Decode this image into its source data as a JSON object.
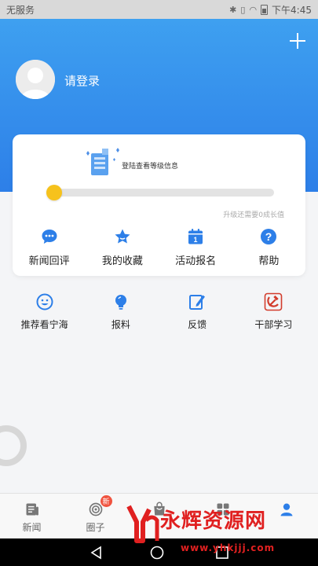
{
  "status_bar": {
    "carrier": "无服务",
    "time": "下午4:45"
  },
  "header": {
    "login_label": "请登录",
    "plus_icon": "plus-icon"
  },
  "card": {
    "level_hint": "登陆查看等级信息",
    "progress_fraction": 0.0,
    "upgrade_note": "升级还需要0成长值",
    "actions": [
      {
        "label": "新闻回评",
        "icon": "chat-bubble-icon"
      },
      {
        "label": "我的收藏",
        "icon": "star-icon"
      },
      {
        "label": "活动报名",
        "icon": "calendar-icon"
      },
      {
        "label": "帮助",
        "icon": "help-icon"
      }
    ]
  },
  "quick_row": [
    {
      "label": "推荐看宁海",
      "icon": "smile-face-icon"
    },
    {
      "label": "报料",
      "icon": "lightbulb-icon"
    },
    {
      "label": "反馈",
      "icon": "pencil-edit-icon"
    },
    {
      "label": "干部学习",
      "icon": "hammer-sickle-icon"
    }
  ],
  "tab_bar": {
    "tabs": [
      {
        "label": "新闻",
        "icon": "news-icon"
      },
      {
        "label": "圈子",
        "icon": "circle-icon",
        "badge": "新"
      },
      {
        "label": "",
        "icon": "shopping-bag-icon"
      },
      {
        "label": "",
        "icon": "grid-icon"
      },
      {
        "label": "",
        "icon": "user-icon",
        "active": true
      }
    ]
  },
  "watermark": {
    "title": "永辉资源网",
    "url": "www.yhkjjj.com"
  },
  "colors": {
    "primary_blue": "#2d7fe8",
    "knob_yellow": "#f6c21c",
    "badge_red": "#f0533f",
    "watermark_red": "#e02020"
  }
}
